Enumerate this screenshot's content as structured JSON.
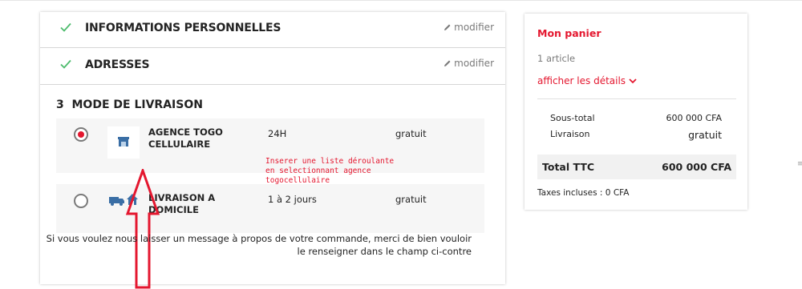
{
  "steps": [
    {
      "number": "",
      "title": "INFORMATIONS PERSONNELLES",
      "edit_label": "modifier",
      "completed": true
    },
    {
      "number": "",
      "title": "ADRESSES",
      "edit_label": "modifier",
      "completed": true
    }
  ],
  "current_step": {
    "number": "3",
    "title": "MODE DE LIVRAISON"
  },
  "delivery_options": [
    {
      "name": "AGENCE TOGO CELLULAIRE",
      "delay": "24H",
      "price": "gratuit",
      "selected": true,
      "icon": "store-icon"
    },
    {
      "name": "LIVRAISON A DOMICILE",
      "delay": "1 à 2 jours",
      "price": "gratuit",
      "selected": false,
      "icon": "truck-home-icon"
    }
  ],
  "annotation": "Inserer une liste déroulante\nen selectionnant agence\ntogocellulaire",
  "message_prompt": "Si vous voulez nous laisser un message à propos de votre commande, merci de bien vouloir le renseigner dans le champ ci-contre",
  "cart": {
    "title": "Mon panier",
    "item_count": "1 article",
    "details_link": "afficher les détails",
    "subtotal_label": "Sous-total",
    "subtotal_value": "600 000 CFA",
    "shipping_label": "Livraison",
    "shipping_value": "gratuit",
    "total_label": "Total TTC",
    "total_value": "600 000 CFA",
    "taxes": "Taxes incluses : 0 CFA"
  },
  "colors": {
    "accent": "#e4172f",
    "check": "#4cbb6c",
    "annotation_arrow": "#e4172f"
  }
}
